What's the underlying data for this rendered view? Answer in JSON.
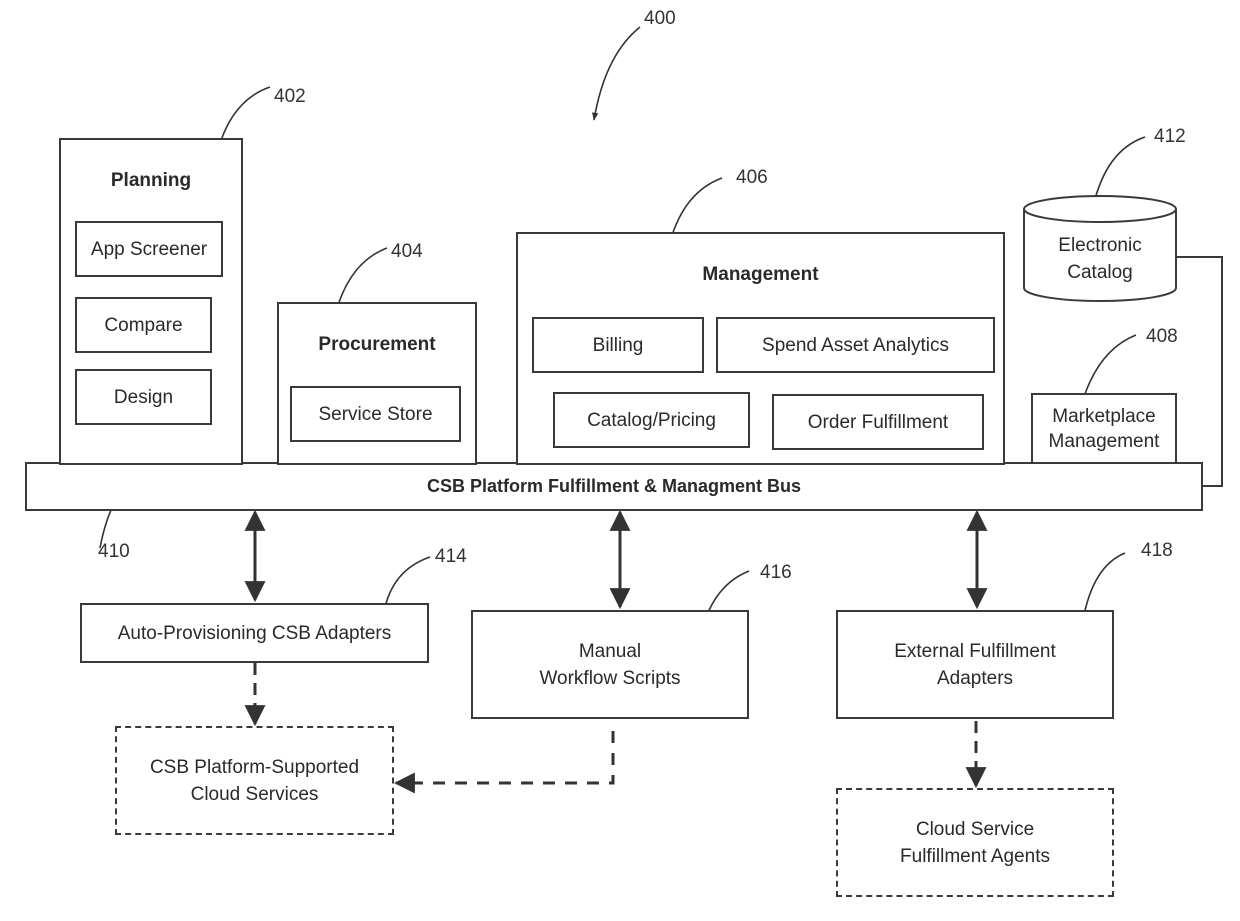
{
  "figure_ref": "400",
  "planning": {
    "ref": "402",
    "title": "Planning",
    "items": [
      "App Screener",
      "Compare",
      "Design"
    ]
  },
  "procurement": {
    "ref": "404",
    "title": "Procurement",
    "items": [
      "Service Store"
    ]
  },
  "management": {
    "ref": "406",
    "title": "Management",
    "items": [
      "Billing",
      "Spend Asset Analytics",
      "Catalog/Pricing",
      "Order Fulfillment"
    ]
  },
  "marketplace": {
    "ref": "408",
    "line1": "Marketplace",
    "line2": "Management"
  },
  "catalog": {
    "ref": "412",
    "line1": "Electronic",
    "line2": "Catalog"
  },
  "bus": {
    "ref": "410",
    "label": "CSB Platform Fulfillment & Managment Bus"
  },
  "auto_adapters": {
    "ref": "414",
    "label": "Auto-Provisioning CSB Adapters"
  },
  "manual_scripts": {
    "ref": "416",
    "line1": "Manual",
    "line2": "Workflow Scripts"
  },
  "external_adapters": {
    "ref": "418",
    "line1": "External Fulfillment",
    "line2": "Adapters"
  },
  "supported_services": {
    "line1": "CSB Platform-Supported",
    "line2": "Cloud Services"
  },
  "fulfillment_agents": {
    "line1": "Cloud Service",
    "line2": "Fulfillment Agents"
  }
}
